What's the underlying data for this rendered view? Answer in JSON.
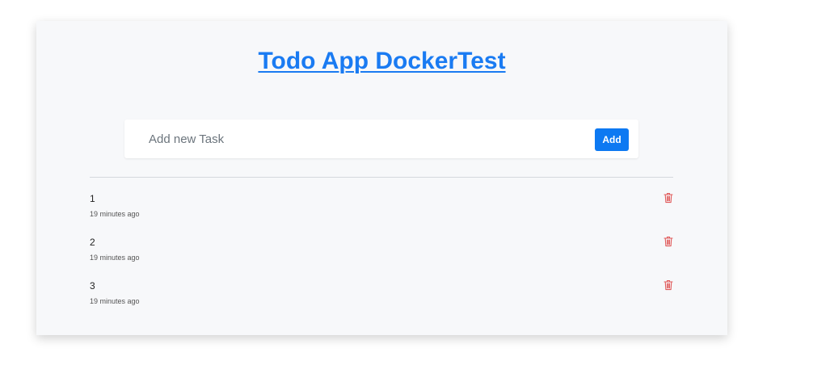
{
  "header": {
    "title": "Todo App DockerTest"
  },
  "form": {
    "placeholder": "Add new Task",
    "add_label": "Add"
  },
  "colors": {
    "accent": "#0d79f2",
    "title_link": "#1a7bf2",
    "delete": "#e05a5a"
  },
  "tasks": [
    {
      "name": "1",
      "time": "19 minutes ago",
      "icon": "trash-icon"
    },
    {
      "name": "2",
      "time": "19 minutes ago",
      "icon": "trash-icon"
    },
    {
      "name": "3",
      "time": "19 minutes ago",
      "icon": "trash-icon"
    }
  ]
}
